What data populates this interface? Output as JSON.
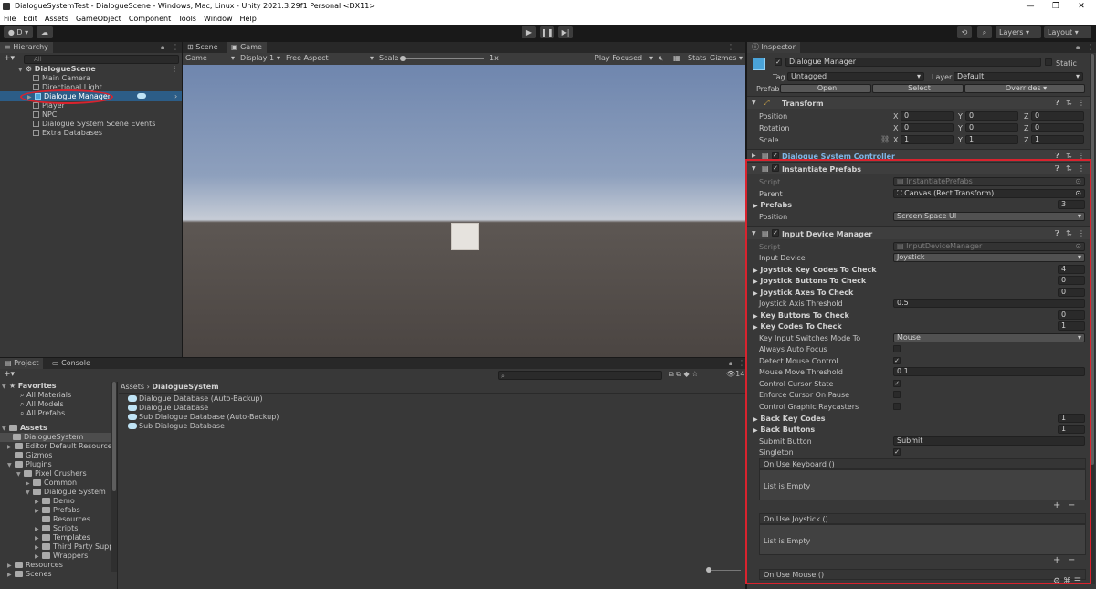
{
  "window": {
    "title": "DialogueSystemTest - DialogueScene - Windows, Mac, Linux - Unity 2021.3.29f1 Personal <DX11>"
  },
  "menu": [
    "File",
    "Edit",
    "Assets",
    "GameObject",
    "Component",
    "Tools",
    "Window",
    "Help"
  ],
  "toolbar": {
    "account": "D",
    "layers": "Layers",
    "layout": "Layout"
  },
  "hierarchy": {
    "tab": "Hierarchy",
    "search_placeholder": "All",
    "scene": "DialogueScene",
    "items": [
      "Main Camera",
      "Directional Light",
      "Dialogue Manager",
      "Player",
      "NPC",
      "Dialogue System Scene Events",
      "Extra Databases"
    ]
  },
  "scene_view": {
    "tabs": [
      "Scene",
      "Game"
    ],
    "game_label": "Game",
    "display": "Display 1",
    "aspect": "Free Aspect",
    "scale_label": "Scale",
    "scale_value": "1x",
    "play_focused": "Play Focused",
    "stats": "Stats",
    "gizmos": "Gizmos"
  },
  "project": {
    "tabs": [
      "Project",
      "Console"
    ],
    "favorites": "Favorites",
    "favorite_items": [
      "All Materials",
      "All Models",
      "All Prefabs"
    ],
    "assets": "Assets",
    "tree": [
      {
        "label": "DialogueSystem",
        "depth": 1
      },
      {
        "label": "Editor Default Resources",
        "depth": 1
      },
      {
        "label": "Gizmos",
        "depth": 1
      },
      {
        "label": "Plugins",
        "depth": 1
      },
      {
        "label": "Pixel Crushers",
        "depth": 2
      },
      {
        "label": "Common",
        "depth": 3
      },
      {
        "label": "Dialogue System",
        "depth": 3
      },
      {
        "label": "Demo",
        "depth": 4
      },
      {
        "label": "Prefabs",
        "depth": 4
      },
      {
        "label": "Resources",
        "depth": 4
      },
      {
        "label": "Scripts",
        "depth": 4
      },
      {
        "label": "Templates",
        "depth": 4
      },
      {
        "label": "Third Party Support",
        "depth": 4
      },
      {
        "label": "Wrappers",
        "depth": 4
      },
      {
        "label": "Resources",
        "depth": 1
      },
      {
        "label": "Scenes",
        "depth": 1
      }
    ],
    "breadcrumb": [
      "Assets",
      "DialogueSystem"
    ],
    "files": [
      "Dialogue Database (Auto-Backup)",
      "Dialogue Database",
      "Sub Dialogue Database (Auto-Backup)",
      "Sub Dialogue Database"
    ],
    "count": "14"
  },
  "inspector": {
    "tab": "Inspector",
    "object_name": "Dialogue Manager",
    "static_label": "Static",
    "tag_label": "Tag",
    "tag_value": "Untagged",
    "layer_label": "Layer",
    "layer_value": "Default",
    "prefab_label": "Prefab",
    "prefab_open": "Open",
    "prefab_select": "Select",
    "prefab_overrides": "Overrides",
    "transform": {
      "title": "Transform",
      "position": {
        "label": "Position",
        "x": "0",
        "y": "0",
        "z": "0"
      },
      "rotation": {
        "label": "Rotation",
        "x": "0",
        "y": "0",
        "z": "0"
      },
      "scale": {
        "label": "Scale",
        "x": "1",
        "y": "1",
        "z": "1"
      }
    },
    "dialogue_controller": "Dialogue System Controller",
    "instantiate": {
      "title": "Instantiate Prefabs",
      "script_label": "Script",
      "script_value": "InstantiatePrefabs",
      "parent_label": "Parent",
      "parent_value": "Canvas (Rect Transform)",
      "prefabs_label": "Prefabs",
      "prefabs_value": "3",
      "position_label": "Position",
      "position_value": "Screen Space UI"
    },
    "input_device": {
      "title": "Input Device Manager",
      "script_label": "Script",
      "script_value": "InputDeviceManager",
      "input_device_label": "Input Device",
      "input_device_value": "Joystick",
      "rows": [
        {
          "label": "Joystick Key Codes To Check",
          "value": "4",
          "kind": "list"
        },
        {
          "label": "Joystick Buttons To Check",
          "value": "0",
          "kind": "list"
        },
        {
          "label": "Joystick Axes To Check",
          "value": "0",
          "kind": "list"
        },
        {
          "label": "Joystick Axis Threshold",
          "value": "0.5",
          "kind": "field"
        },
        {
          "label": "Key Buttons To Check",
          "value": "0",
          "kind": "list"
        },
        {
          "label": "Key Codes To Check",
          "value": "1",
          "kind": "list"
        },
        {
          "label": "Key Input Switches Mode To",
          "value": "Mouse",
          "kind": "dropdown"
        },
        {
          "label": "Always Auto Focus",
          "value": "",
          "kind": "check"
        },
        {
          "label": "Detect Mouse Control",
          "value": "✓",
          "kind": "check"
        },
        {
          "label": "Mouse Move Threshold",
          "value": "0.1",
          "kind": "field"
        },
        {
          "label": "Control Cursor State",
          "value": "✓",
          "kind": "check"
        },
        {
          "label": "Enforce Cursor On Pause",
          "value": "",
          "kind": "check"
        },
        {
          "label": "Control Graphic Raycasters",
          "value": "",
          "kind": "check"
        },
        {
          "label": "Back Key Codes",
          "value": "1",
          "kind": "list"
        },
        {
          "label": "Back Buttons",
          "value": "1",
          "kind": "list"
        },
        {
          "label": "Submit Button",
          "value": "Submit",
          "kind": "field"
        },
        {
          "label": "Singleton",
          "value": "✓",
          "kind": "check"
        }
      ],
      "events": [
        {
          "title": "On Use Keyboard ()",
          "empty": "List is Empty"
        },
        {
          "title": "On Use Joystick ()",
          "empty": "List is Empty"
        },
        {
          "title": "On Use Mouse ()",
          "empty": ""
        }
      ]
    }
  },
  "colors": {
    "highlight": "#d9232e",
    "selection": "#2c5d87",
    "sky": "#7a8fb0",
    "ground": "#4b4542"
  }
}
